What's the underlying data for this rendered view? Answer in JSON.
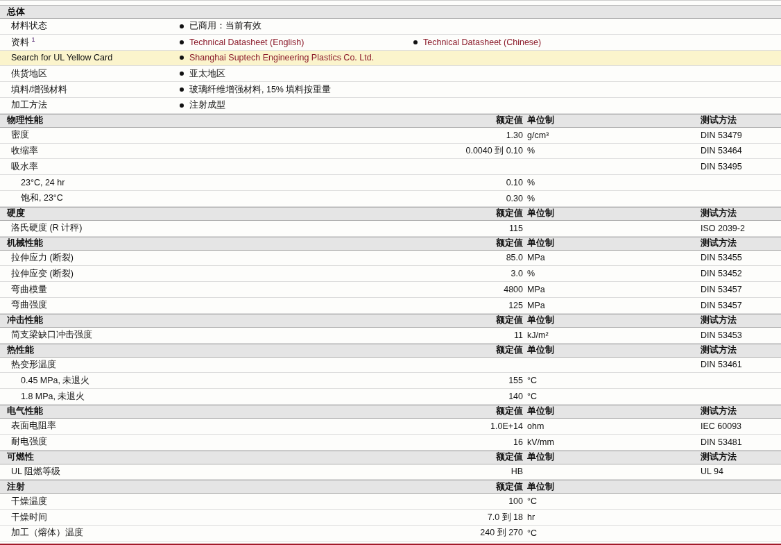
{
  "general": {
    "title": "总体",
    "rows": [
      {
        "label": "材料状态",
        "highlighted": false,
        "items": [
          {
            "kind": "text",
            "text": "已商用：当前有效"
          }
        ]
      },
      {
        "label": "资料 $^{1}$",
        "highlighted": false,
        "items": [
          {
            "kind": "link",
            "text": "Technical Datasheet (English)"
          },
          {
            "kind": "link",
            "text": "Technical Datasheet (Chinese)"
          }
        ]
      },
      {
        "label": "Search for UL Yellow Card",
        "highlighted": true,
        "items": [
          {
            "kind": "link",
            "text": "Shanghai Suptech Engineering Plastics Co. Ltd."
          }
        ]
      },
      {
        "label": "供货地区",
        "highlighted": false,
        "items": [
          {
            "kind": "text",
            "text": "亚太地区"
          }
        ]
      },
      {
        "label": "填料/增强材料",
        "highlighted": false,
        "items": [
          {
            "kind": "text",
            "text": "玻璃纤维增强材料, 15% 填料按重量"
          }
        ]
      },
      {
        "label": "加工方法",
        "highlighted": false,
        "items": [
          {
            "kind": "text",
            "text": "注射成型"
          }
        ]
      }
    ]
  },
  "sections": [
    {
      "title": "物理性能",
      "value_heading": "额定值",
      "unit_heading": "单位制",
      "test_heading": "测试方法",
      "rows": [
        {
          "label": "密度",
          "value": "1.30",
          "unit": "g/cm³",
          "test": "DIN 53479"
        },
        {
          "label": "收缩率",
          "value": "0.0040 到  0.10",
          "unit": "%",
          "test": "DIN 53464"
        },
        {
          "label": "吸水率",
          "test": "DIN 53495",
          "children": [
            {
              "label": "23°C, 24 hr",
              "value": "0.10",
              "unit": "%"
            },
            {
              "label": "饱和, 23°C",
              "value": "0.30",
              "unit": "%"
            }
          ]
        }
      ]
    },
    {
      "title": "硬度",
      "value_heading": "额定值",
      "unit_heading": "单位制",
      "test_heading": "测试方法",
      "rows": [
        {
          "label": "洛氏硬度 (R 计秤)",
          "value": "115",
          "test": "ISO 2039-2"
        }
      ]
    },
    {
      "title": "机械性能",
      "value_heading": "额定值",
      "unit_heading": "单位制",
      "test_heading": "测试方法",
      "rows": [
        {
          "label": "拉伸应力 (断裂)",
          "value": "85.0",
          "unit": "MPa",
          "test": "DIN 53455"
        },
        {
          "label": "拉伸应变 (断裂)",
          "value": "3.0",
          "unit": "%",
          "test": "DIN 53452"
        },
        {
          "label": "弯曲模量",
          "value": "4800",
          "unit": "MPa",
          "test": "DIN 53457"
        },
        {
          "label": "弯曲强度",
          "value": "125",
          "unit": "MPa",
          "test": "DIN 53457"
        }
      ]
    },
    {
      "title": "冲击性能",
      "value_heading": "额定值",
      "unit_heading": "单位制",
      "test_heading": "测试方法",
      "rows": [
        {
          "label": "简支梁缺口冲击强度",
          "value": "11",
          "unit": "kJ/m²",
          "test": "DIN 53453"
        }
      ]
    },
    {
      "title": "热性能",
      "value_heading": "额定值",
      "unit_heading": "单位制",
      "test_heading": "测试方法",
      "rows": [
        {
          "label": "热变形温度",
          "test": "DIN 53461",
          "children": [
            {
              "label": "0.45 MPa, 未退火",
              "value": "155",
              "unit": "°C"
            },
            {
              "label": "1.8 MPa, 未退火",
              "value": "140",
              "unit": "°C"
            }
          ]
        }
      ]
    },
    {
      "title": "电气性能",
      "value_heading": "额定值",
      "unit_heading": "单位制",
      "test_heading": "测试方法",
      "rows": [
        {
          "label": "表面电阻率",
          "value": "1.0E+14",
          "unit": "ohm",
          "test": "IEC 60093"
        },
        {
          "label": "耐电强度",
          "value": "16",
          "unit": "kV/mm",
          "test": "DIN 53481"
        }
      ]
    },
    {
      "title": "可燃性",
      "value_heading": "额定值",
      "unit_heading": "单位制",
      "test_heading": "测试方法",
      "rows": [
        {
          "label": "UL 阻燃等级",
          "value": "HB",
          "test": "UL 94"
        }
      ]
    },
    {
      "title": "注射",
      "value_heading": "额定值",
      "unit_heading": "单位制",
      "rows": [
        {
          "label": "干燥温度",
          "value": "100",
          "unit": "°C"
        },
        {
          "label": "干燥时间",
          "value": "7.0 到  18",
          "unit": "hr"
        },
        {
          "label": "加工（熔体）温度",
          "value": "240 到  270",
          "unit": "°C"
        }
      ]
    }
  ]
}
